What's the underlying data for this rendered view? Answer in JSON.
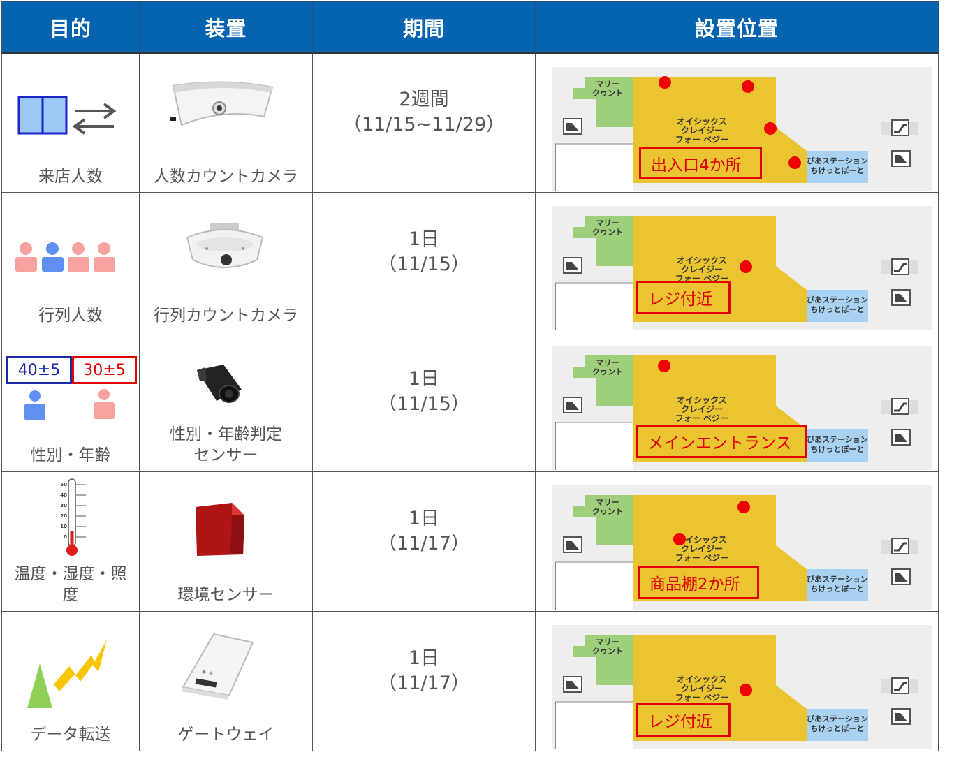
{
  "header": {
    "purpose": "目的",
    "device": "装置",
    "period": "期間",
    "location": "設置位置"
  },
  "rows": [
    {
      "purpose": "来店人数",
      "device": "人数カウントカメラ",
      "period_line1": "2週間",
      "period_line2": "（11/15~11/29）",
      "tag": "出入口4か所"
    },
    {
      "purpose": "行列人数",
      "device": "行列カウントカメラ",
      "period_line1": "1日",
      "period_line2": "（11/15）",
      "tag": "レジ付近"
    },
    {
      "purpose": "性別・年齢",
      "device_line1": "性別・年齢判定",
      "device_line2": "センサー",
      "period_line1": "1日",
      "period_line2": "（11/15）",
      "tag": "メインエントランス",
      "age_male": "40±5",
      "age_female": "30±5"
    },
    {
      "purpose_line1": "温度・湿度・照",
      "purpose_line2": "度",
      "device": "環境センサー",
      "period_line1": "1日",
      "period_line2": "（11/17）",
      "tag": "商品棚2か所",
      "thermo_ticks": [
        "50",
        "40",
        "30",
        "20",
        "10",
        "0"
      ]
    },
    {
      "purpose": "データ転送",
      "device": "ゲートウェイ",
      "period_line1": "1日",
      "period_line2": "（11/17）",
      "tag": "レジ付近"
    }
  ],
  "map": {
    "shop_green": "マリー\nクヮント",
    "shop_yellow_1": "オイシックス",
    "shop_yellow_2": "クレイジー",
    "shop_yellow_3": "フォー ベジー",
    "shop_blue_1": "ぴあステーション",
    "shop_blue_2": "ちけっとぽーと"
  },
  "colors": {
    "header_bg": "#0563b0",
    "sensor_dot": "#ee0000",
    "store_yellow": "#ebc431",
    "store_green": "#9fcf7a",
    "store_blue": "#a9d1f2",
    "map_bg": "#eeeeee"
  }
}
